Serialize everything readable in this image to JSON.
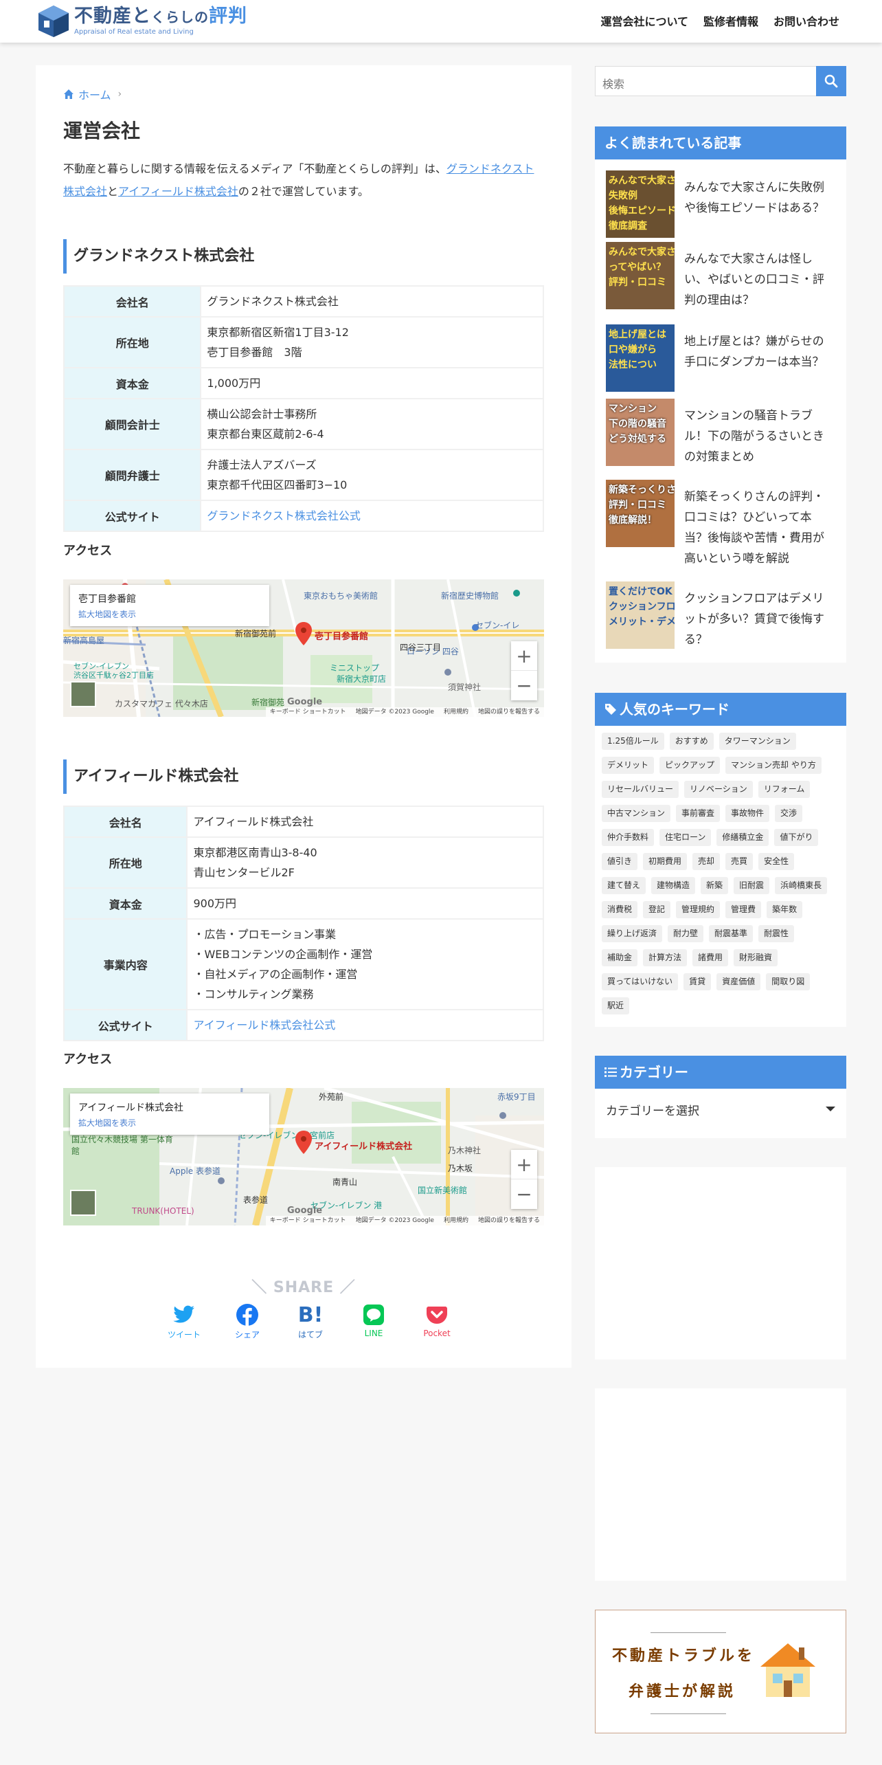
{
  "header": {
    "logo_main_a": "不動産と",
    "logo_main_b": "くらしの",
    "logo_main_c": "評判",
    "logo_sub": "Appraisal of Real estate and Living",
    "nav": [
      "運営会社について",
      "監修者情報",
      "お問い合わせ"
    ]
  },
  "breadcrumb": {
    "home": "ホーム"
  },
  "page": {
    "title": "運営会社",
    "intro_a": "不動産と暮らしに関する情報を伝えるメディア「不動産とくらしの評判」は、",
    "intro_link1": "グランドネクスト株式会社",
    "intro_b": "と",
    "intro_link2": "アイフィールド株式会社",
    "intro_c": "の２社で運営しています。"
  },
  "company1": {
    "heading": "グランドネクスト株式会社",
    "rows": [
      {
        "label": "会社名",
        "lines": [
          "グランドネクスト株式会社"
        ]
      },
      {
        "label": "所在地",
        "lines": [
          "東京都新宿区新宿1丁目3-12",
          "壱丁目参番館　3階"
        ]
      },
      {
        "label": "資本金",
        "lines": [
          "1,000万円"
        ]
      },
      {
        "label": "顧問会計士",
        "lines": [
          "横山公認会計士事務所",
          "東京都台東区蔵前2-6-4"
        ]
      },
      {
        "label": "顧問弁護士",
        "lines": [
          "弁護士法人アズバーズ",
          "東京都千代田区四番町3−10"
        ]
      },
      {
        "label": "公式サイト",
        "link": "グランドネクスト株式会社公式"
      }
    ],
    "access": "アクセス",
    "map": {
      "place": "壱丁目参番館",
      "enlarge": "拡大地図を表示",
      "pin_label": "壱丁目参番館",
      "labels": [
        "東京おもちゃ美術館",
        "新宿歴史博物館",
        "新宿御苑前",
        "四谷三丁目",
        "ミニストップ",
        "新宿大京町店",
        "ローソン 四谷",
        "セブン-イレ",
        "須賀神社",
        "新宿高島屋",
        "セブン-イレブン",
        "渋谷区千駄ヶ谷2丁目店",
        "カスタマカフェ 代々木店",
        "新宿御苑"
      ],
      "footer": [
        "キーボード ショートカット",
        "地図データ ©2023 Google",
        "利用規約",
        "地図の誤りを報告する"
      ]
    }
  },
  "company2": {
    "heading": "アイフィールド株式会社",
    "rows": [
      {
        "label": "会社名",
        "lines": [
          "アイフィールド株式会社"
        ]
      },
      {
        "label": "所在地",
        "lines": [
          "東京都港区南青山3-8-40",
          "青山センタービル2F"
        ]
      },
      {
        "label": "資本金",
        "lines": [
          "900万円"
        ]
      },
      {
        "label": "事業内容",
        "lines": [
          "・広告・プロモーション事業",
          "・WEBコンテンツの企画制作・運営",
          "・自社メディアの企画制作・運営",
          "・コンサルティング業務"
        ]
      },
      {
        "label": "公式サイト",
        "link": "アイフィールド株式会社公式"
      }
    ],
    "access": "アクセス",
    "map": {
      "place": "アイフィールド株式会社",
      "enlarge": "拡大地図を表示",
      "pin_label": "アイフィールド株式会社",
      "labels": [
        "外苑前",
        "赤坂9丁目",
        "セブン-イレブン 神宮前店",
        "乃木神社",
        "国立代々木競技場 第一体育館",
        "乃木坂",
        "Apple 表参道",
        "南青山",
        "国立新美術館",
        "表参道",
        "TRUNK(HOTEL)",
        "セブン-イレブン 港"
      ],
      "footer": [
        "キーボード ショートカット",
        "地図データ ©2023 Google",
        "利用規約",
        "地図の誤りを報告する"
      ]
    }
  },
  "share": {
    "title": "＼ SHARE ／",
    "buttons": [
      {
        "label": "ツイート",
        "color": "#1da1f2"
      },
      {
        "label": "シェア",
        "color": "#1877f2"
      },
      {
        "label": "はてブ",
        "color": "#2c6ebd"
      },
      {
        "label": "LINE",
        "color": "#06c755"
      },
      {
        "label": "Pocket",
        "color": "#ef4056"
      }
    ]
  },
  "sidebar": {
    "search_placeholder": "検索",
    "popular_title": "よく読まれている記事",
    "popular": [
      {
        "title": "みんなで大家さんに失敗例や後悔エピソードはある？",
        "thumb_text": "みんなで大家さん\n失敗例\n後悔エピソード\n徹底調査"
      },
      {
        "title": "みんなで大家さんは怪しい、やばいとの口コミ・評判の理由は？",
        "thumb_text": "みんなで大家さん\nってやばい？\n評判・口コミ"
      },
      {
        "title": "地上げ屋とは？嫌がらせの手口にダンプカーは本当？",
        "thumb_text": "地上げ屋とは\n口や嫌がら\n法性につい"
      },
      {
        "title": "マンションの騒音トラブル！下の階がうるさいときの対策まとめ",
        "thumb_text": "マンション\n下の階の騒音\nどう対処する"
      },
      {
        "title": "新築そっくりさんの評判・口コミは？ひどいって本当？後悔談や苦情・費用が高いという噂を解説",
        "thumb_text": "新築そっくりさん\n評判・口コミ\n徹底解説！"
      },
      {
        "title": "クッションフロアはデメリットが多い？賃貸で後悔する？",
        "thumb_text": "置くだけでOK\nクッションフロ\nメリット・デメリ"
      }
    ],
    "keywords_title": "人気のキーワード",
    "keywords": [
      "1.25倍ルール",
      "おすすめ",
      "タワーマンション",
      "デメリット",
      "ピックアップ",
      "マンション売却 やり方",
      "リセールバリュー",
      "リノベーション",
      "リフォーム",
      "中古マンション",
      "事前審査",
      "事故物件",
      "交渉",
      "仲介手数料",
      "住宅ローン",
      "修繕積立金",
      "値下がり",
      "値引き",
      "初期費用",
      "売却",
      "売買",
      "安全性",
      "建て替え",
      "建物構造",
      "新築",
      "旧耐震",
      "浜崎橋東長",
      "消費税",
      "登記",
      "管理規約",
      "管理費",
      "築年数",
      "繰り上げ返済",
      "耐力壁",
      "耐震基準",
      "耐震性",
      "補助金",
      "計算方法",
      "諸費用",
      "財形融資",
      "買ってはいけない",
      "賃貸",
      "資産価値",
      "間取り図",
      "駅近"
    ],
    "category_title": "カテゴリー",
    "category_select": "カテゴリーを選択",
    "banner_line1": "不動産トラブルを",
    "banner_line2": "弁護士が解説"
  }
}
